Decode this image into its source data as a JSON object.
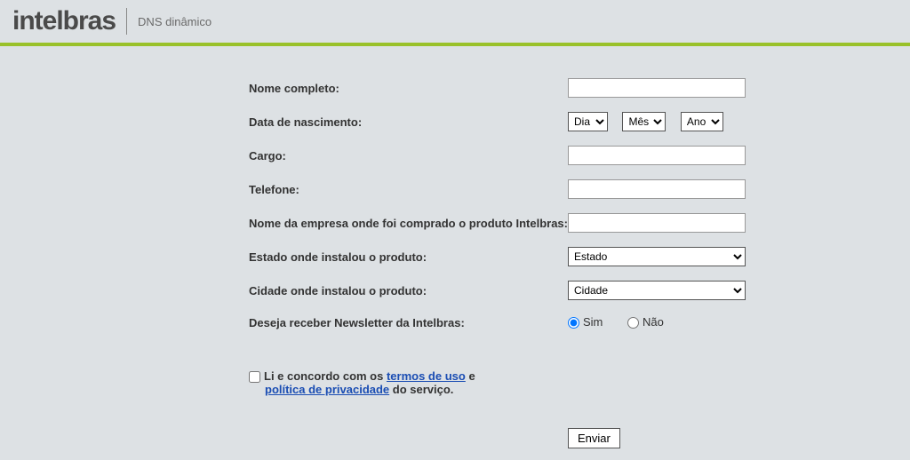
{
  "header": {
    "logo_text": "intelbras",
    "subtitle": "DNS dinâmico"
  },
  "form": {
    "labels": {
      "nome_completo": "Nome completo:",
      "data_nascimento": "Data de nascimento:",
      "cargo": "Cargo:",
      "telefone": "Telefone:",
      "empresa": "Nome da empresa onde foi comprado o produto Intelbras:",
      "estado": "Estado onde instalou o produto:",
      "cidade": "Cidade onde instalou o produto:",
      "newsletter": "Deseja receber Newsletter da Intelbras:"
    },
    "selects": {
      "dia": "Dia",
      "mes": "Mês",
      "ano": "Ano",
      "estado": "Estado",
      "cidade": "Cidade"
    },
    "radios": {
      "sim": "Sim",
      "nao": "Não"
    },
    "agree": {
      "prefix": "Li e concordo com os ",
      "link1": "termos de uso",
      "middle": " e",
      "link2": "política de privacidade",
      "suffix": " do serviço."
    },
    "submit_label": "Enviar"
  }
}
